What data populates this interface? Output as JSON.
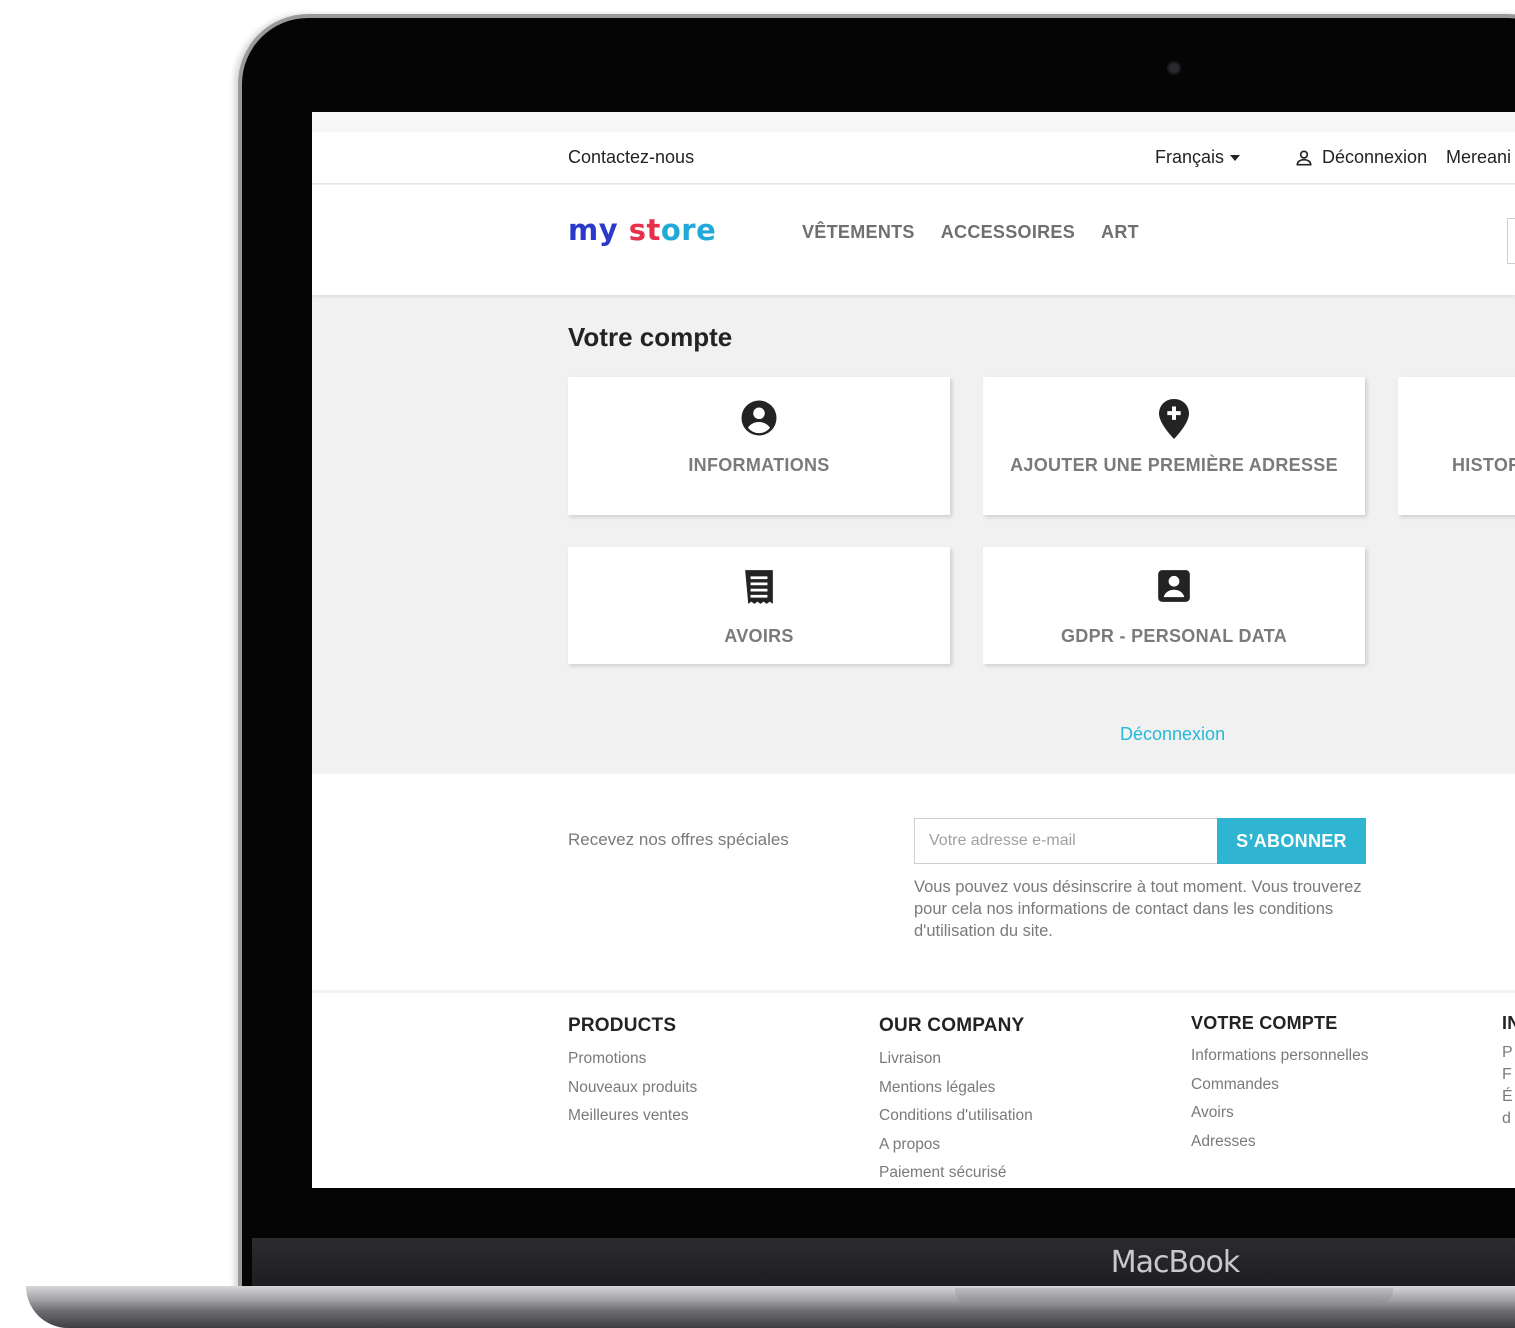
{
  "device": {
    "brand": "MacBook"
  },
  "topbar": {
    "contact": "Contactez-nous",
    "language": "Français",
    "logout": "Déconnexion",
    "user": "Mereani"
  },
  "header": {
    "logo": {
      "part1": "my",
      "part2": "st",
      "part3": "ore"
    },
    "nav": [
      "VÊTEMENTS",
      "ACCESSOIRES",
      "ART"
    ]
  },
  "account": {
    "title": "Votre compte",
    "cards": [
      {
        "label": "INFORMATIONS",
        "icon": "account-circle-icon"
      },
      {
        "label": "AJOUTER UNE PREMIÈRE ADRESSE",
        "icon": "add-location-icon"
      },
      {
        "label": "HISTOR",
        "icon": ""
      },
      {
        "label": "AVOIRS",
        "icon": "receipt-icon"
      },
      {
        "label": "GDPR - PERSONAL DATA",
        "icon": "account-box-icon"
      }
    ],
    "logout": "Déconnexion"
  },
  "newsletter": {
    "text": "Recevez nos offres spéciales",
    "placeholder": "Votre adresse e-mail",
    "button": "S’ABONNER",
    "note": "Vous pouvez vous désinscrire à tout moment. Vous trouverez pour cela nos informations de contact dans les conditions d'utilisation du site."
  },
  "footer": {
    "products": {
      "title": "PRODUCTS",
      "links": [
        "Promotions",
        "Nouveaux produits",
        "Meilleures ventes"
      ]
    },
    "company": {
      "title": "OUR COMPANY",
      "links": [
        "Livraison",
        "Mentions légales",
        "Conditions d'utilisation",
        "A propos",
        "Paiement sécurisé"
      ]
    },
    "account": {
      "title": "VOTRE COMPTE",
      "links": [
        "Informations personnelles",
        "Commandes",
        "Avoirs",
        "Adresses"
      ]
    },
    "store": {
      "title": "IN",
      "lines": [
        "P",
        "F",
        "É",
        "d"
      ]
    }
  },
  "colors": {
    "accent": "#2fb5d2",
    "link": "#24b9d7",
    "text": "#232323",
    "muted": "#7a7a7a"
  }
}
